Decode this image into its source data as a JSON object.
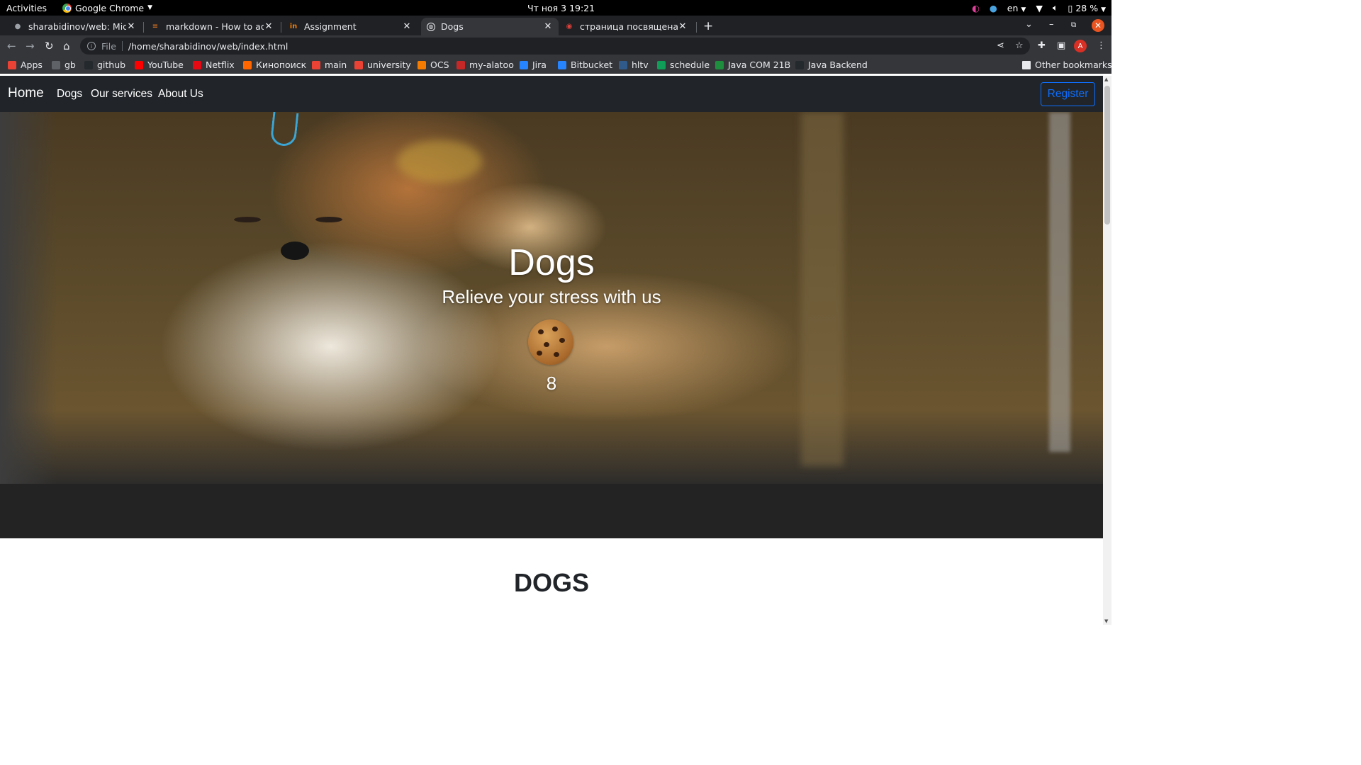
{
  "system": {
    "activities": "Activities",
    "app_name": "Google Chrome",
    "clock": "Чт ноя 3  19:21",
    "lang": "en",
    "battery": "28 %"
  },
  "tabs": [
    {
      "title": "sharabidinov/web: Midte",
      "active": false
    },
    {
      "title": "markdown - How to add i",
      "active": false
    },
    {
      "title": "Assignment",
      "active": false
    },
    {
      "title": "Dogs",
      "active": true
    },
    {
      "title": "страница посвящена соб",
      "active": false
    }
  ],
  "omnibox": {
    "scheme": "File",
    "url": "/home/sharabidinov/web/index.html"
  },
  "bookmarks": [
    {
      "label": "Apps",
      "icon": "apps-grid-icon",
      "color": "#ea4335"
    },
    {
      "label": "gb",
      "icon": "gb-icon",
      "color": "#5f6368"
    },
    {
      "label": "github",
      "icon": "github-icon",
      "color": "#24292e"
    },
    {
      "label": "YouTube",
      "icon": "youtube-icon",
      "color": "#ff0000"
    },
    {
      "label": "Netflix",
      "icon": "netflix-icon",
      "color": "#e50914"
    },
    {
      "label": "Кинопоиск",
      "icon": "kinopoisk-icon",
      "color": "#ff6600"
    },
    {
      "label": "main",
      "icon": "gmail-icon",
      "color": "#ea4335"
    },
    {
      "label": "university",
      "icon": "gmail-icon",
      "color": "#ea4335"
    },
    {
      "label": "OCS",
      "icon": "ocs-icon",
      "color": "#f57c00"
    },
    {
      "label": "my-alatoo",
      "icon": "alatoo-icon",
      "color": "#c62828"
    },
    {
      "label": "Jira",
      "icon": "jira-icon",
      "color": "#2684ff"
    },
    {
      "label": "Bitbucket",
      "icon": "bitbucket-icon",
      "color": "#2684ff"
    },
    {
      "label": "hltv",
      "icon": "hltv-icon",
      "color": "#2f5a8a"
    },
    {
      "label": "schedule",
      "icon": "sheets-icon",
      "color": "#0f9d58"
    },
    {
      "label": "Java COM 21B",
      "icon": "classroom-icon",
      "color": "#1e8e3e"
    },
    {
      "label": "Java Backend",
      "icon": "github-icon",
      "color": "#24292e"
    }
  ],
  "other_bookmarks": "Other bookmarks",
  "site": {
    "brand": "Home",
    "nav": [
      "Dogs",
      "Our services",
      "About Us"
    ],
    "register": "Register",
    "accent": "#0d6efd",
    "navbar_bg": "#212529"
  },
  "hero": {
    "title": "Dogs",
    "subtitle": "Relieve your stress with us",
    "cookie_icon": "cookie-icon",
    "counter": "8"
  },
  "section": {
    "title": "DOGS"
  }
}
